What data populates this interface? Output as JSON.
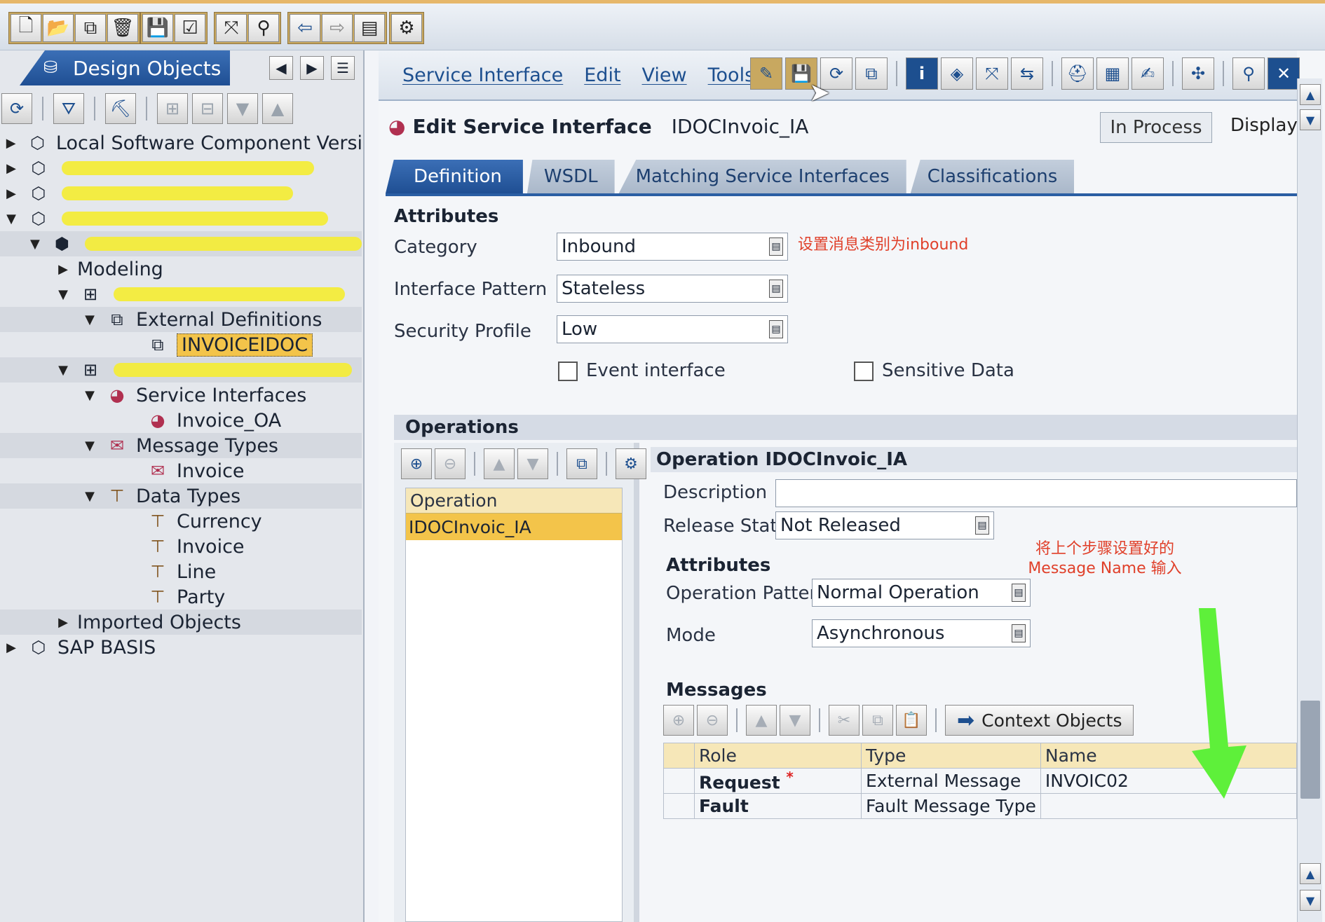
{
  "design_objects_tab": "Design Objects",
  "tree": [
    {
      "label": "Local Software Component Versio",
      "indent": 0,
      "expand": "right",
      "icon": "swcv-icon",
      "shade": false
    },
    {
      "label": "",
      "indent": 0,
      "expand": "right",
      "icon": "swcv-icon",
      "shade": false,
      "redacted": 360
    },
    {
      "label": "",
      "indent": 0,
      "expand": "right",
      "icon": "swcv-icon",
      "shade": false,
      "redacted": 330
    },
    {
      "label": "",
      "indent": 0,
      "expand": "down",
      "icon": "swcv-icon",
      "shade": false,
      "redacted": 380
    },
    {
      "label": "",
      "indent": 1,
      "expand": "down",
      "icon": "swcv-version-icon",
      "shade": true,
      "redacted": 400
    },
    {
      "label": "Modeling",
      "indent": 3,
      "expand": "right",
      "icon": "",
      "shade": false
    },
    {
      "label": "",
      "indent": 3,
      "expand": "down",
      "icon": "namespace-icon",
      "shade": false,
      "redacted": 330
    },
    {
      "label": "External Definitions",
      "indent": 4,
      "expand": "down",
      "icon": "external-def-folder-icon",
      "shade": true
    },
    {
      "label": "INVOICEIDOC",
      "indent": 5,
      "expand": "",
      "icon": "external-def-icon",
      "shade": false,
      "selected": true
    },
    {
      "label": "",
      "indent": 3,
      "expand": "down",
      "icon": "namespace-icon",
      "shade": true,
      "redacted": 340
    },
    {
      "label": "Service Interfaces",
      "indent": 4,
      "expand": "down",
      "icon": "service-interface-icon",
      "shade": false
    },
    {
      "label": "Invoice_OA",
      "indent": 5,
      "expand": "",
      "icon": "service-interface-icon",
      "shade": false
    },
    {
      "label": "Message Types",
      "indent": 4,
      "expand": "down",
      "icon": "message-type-icon",
      "shade": true
    },
    {
      "label": "Invoice",
      "indent": 5,
      "expand": "",
      "icon": "message-type-icon",
      "shade": false
    },
    {
      "label": "Data Types",
      "indent": 4,
      "expand": "down",
      "icon": "data-type-folder-icon",
      "shade": true
    },
    {
      "label": "Currency",
      "indent": 5,
      "expand": "",
      "icon": "data-type-icon",
      "shade": false
    },
    {
      "label": "Invoice",
      "indent": 5,
      "expand": "",
      "icon": "data-type-icon",
      "shade": false
    },
    {
      "label": "Line",
      "indent": 5,
      "expand": "",
      "icon": "data-type-icon",
      "shade": false
    },
    {
      "label": "Party",
      "indent": 5,
      "expand": "",
      "icon": "data-type-icon",
      "shade": false
    },
    {
      "label": "Imported Objects",
      "indent": 3,
      "expand": "right",
      "icon": "",
      "shade": true
    },
    {
      "label": "SAP BASIS",
      "indent": 0,
      "expand": "right",
      "icon": "swcv-icon",
      "shade": false
    }
  ],
  "menu": [
    "Service Interface",
    "Edit",
    "View",
    "Tools"
  ],
  "editor": {
    "title_bold": "Edit Service Interface",
    "object_name": "IDOCInvoic_IA",
    "status": "In Process",
    "display": "Display"
  },
  "tabs": [
    "Definition",
    "WSDL",
    "Matching Service Interfaces",
    "Classifications"
  ],
  "attributes": {
    "heading": "Attributes",
    "category_label": "Category",
    "category_value": "Inbound",
    "pattern_label": "Interface Pattern",
    "pattern_value": "Stateless",
    "security_label": "Security Profile",
    "security_value": "Low",
    "event_label": "Event interface",
    "sensitive_label": "Sensitive Data"
  },
  "annotations": {
    "category_note": "设置消息类别为inbound",
    "message_note_line1": "将上个步骤设置好的",
    "message_note_line2": "Message Name 输入"
  },
  "operations": {
    "heading": "Operations",
    "column": "Operation",
    "rows": [
      "IDOCInvoic_IA"
    ]
  },
  "operation_detail": {
    "title": "Operation IDOCInvoic_IA",
    "description_label": "Description",
    "description_value": "",
    "release_label": "Release State",
    "release_value": "Not Released",
    "attr_heading": "Attributes",
    "op_pattern_label": "Operation Pattern",
    "op_pattern_value": "Normal Operation",
    "mode_label": "Mode",
    "mode_value": "Asynchronous",
    "messages_heading": "Messages",
    "context_button": "Context Objects",
    "columns": [
      "Role",
      "Type",
      "Name"
    ],
    "rows": [
      {
        "role": "Request",
        "required": "*",
        "type": "External Message",
        "name": "INVOIC02"
      },
      {
        "role": "Fault",
        "required": "",
        "type": "Fault Message Type",
        "name": ""
      }
    ]
  },
  "colors": {
    "accent_blue": "#1f4f93",
    "selection_yellow": "#f3c44a",
    "annotation_red": "#e0402a",
    "arrow_green": "#5ef03a"
  }
}
